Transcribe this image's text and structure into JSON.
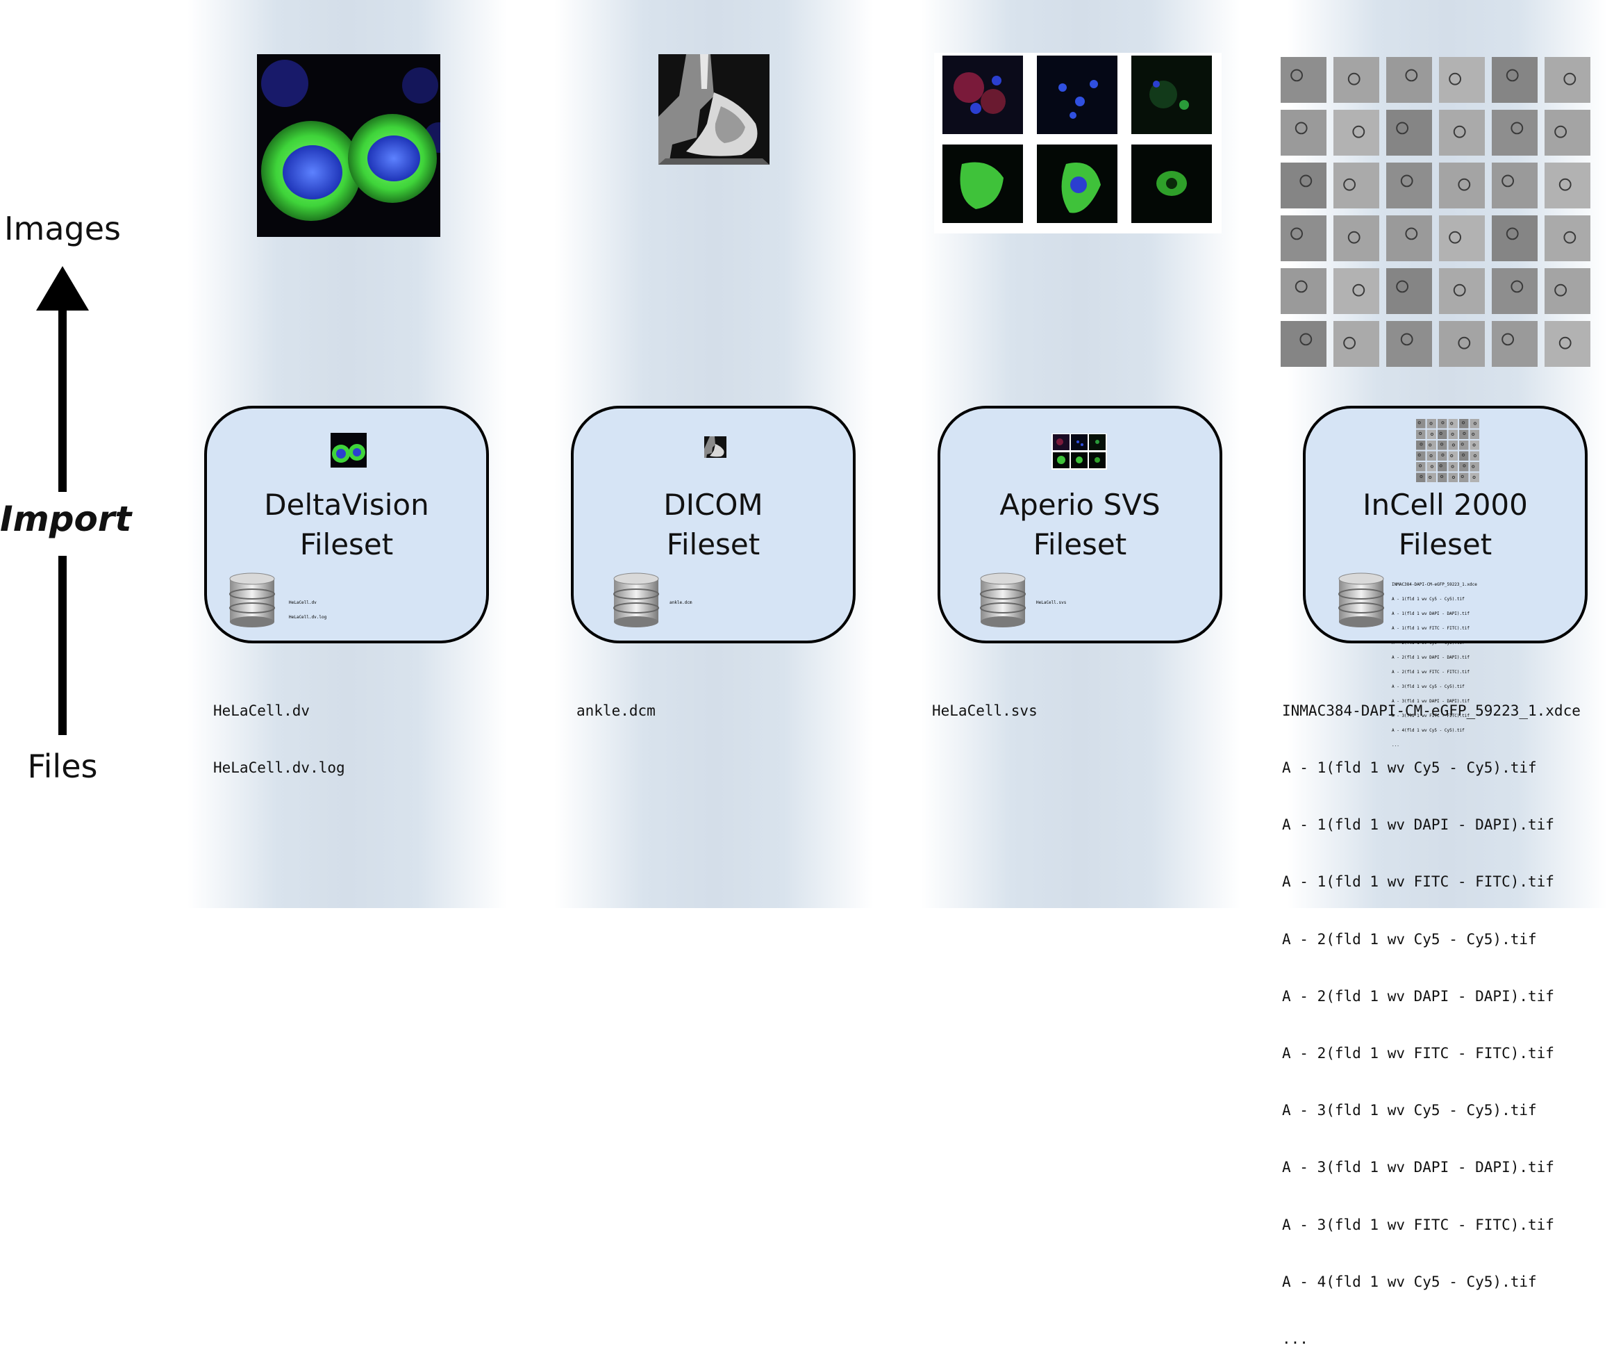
{
  "axis": {
    "top_label": "Images",
    "middle_label": "Import",
    "bottom_label": "Files"
  },
  "columns": [
    {
      "id": "deltavision",
      "title_line1": "DeltaVision",
      "title_line2": "Fileset",
      "tiny_files": [
        "HeLaCell.dv",
        "HeLaCell.dv.log"
      ],
      "files": [
        "HeLaCell.dv",
        "HeLaCell.dv.log"
      ]
    },
    {
      "id": "dicom",
      "title_line1": "DICOM",
      "title_line2": "Fileset",
      "tiny_files": [
        "ankle.dcm"
      ],
      "files": [
        "ankle.dcm"
      ]
    },
    {
      "id": "aperio",
      "title_line1": "Aperio SVS",
      "title_line2": "Fileset",
      "tiny_files": [
        "HeLaCell.svs"
      ],
      "files": [
        "HeLaCell.svs"
      ]
    },
    {
      "id": "incell",
      "title_line1": "InCell 2000",
      "title_line2": "Fileset",
      "tiny_files": [
        "INMAC384-DAPI-CM-eGFP_59223_1.xdce",
        "A - 1(fld 1 wv Cy5 - Cy5).tif",
        "A - 1(fld 1 wv DAPI - DAPI).tif",
        "A - 1(fld 1 wv FITC - FITC).tif",
        "A - 2(fld 1 wv Cy5 - Cy5).tif",
        "A - 2(fld 1 wv DAPI - DAPI).tif",
        "A - 2(fld 1 wv FITC - FITC).tif",
        "A - 3(fld 1 wv Cy5 - Cy5).tif",
        "A - 3(fld 1 wv DAPI - DAPI).tif",
        "A - 3(fld 1 wv FITC - FITC).tif",
        "A - 4(fld 1 wv Cy5 - Cy5).tif",
        "..."
      ],
      "files": [
        "INMAC384-DAPI-CM-eGFP_59223_1.xdce",
        "A - 1(fld 1 wv Cy5 - Cy5).tif",
        "A - 1(fld 1 wv DAPI - DAPI).tif",
        "A - 1(fld 1 wv FITC - FITC).tif",
        "A - 2(fld 1 wv Cy5 - Cy5).tif",
        "A - 2(fld 1 wv DAPI - DAPI).tif",
        "A - 2(fld 1 wv FITC - FITC).tif",
        "A - 3(fld 1 wv Cy5 - Cy5).tif",
        "A - 3(fld 1 wv DAPI - DAPI).tif",
        "A - 3(fld 1 wv FITC - FITC).tif",
        "A - 4(fld 1 wv Cy5 - Cy5).tif",
        "..."
      ]
    }
  ],
  "colors": {
    "box_fill": "#d6e4f5",
    "band": "#d4dee9",
    "green_cell": "#3fd43a",
    "nucleus_blue": "#2b3fd0"
  },
  "icons": [
    "database-icon",
    "up-arrow-icon"
  ]
}
